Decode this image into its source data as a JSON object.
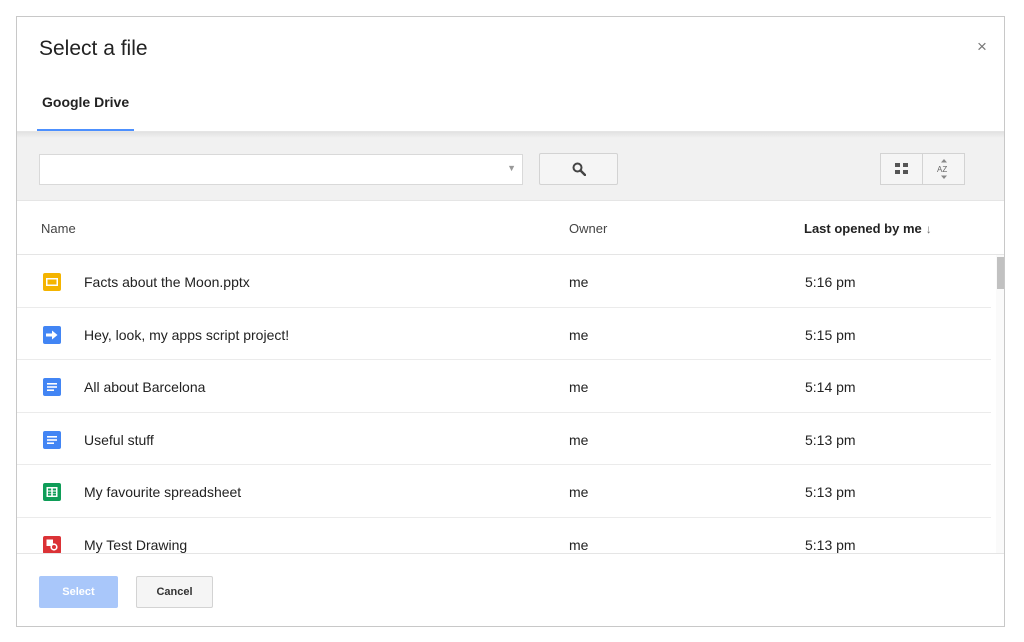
{
  "dialog": {
    "title": "Select a file",
    "close_icon": "close-icon",
    "close_glyph": "×",
    "tabs": [
      {
        "label": "Google Drive",
        "active": true
      }
    ]
  },
  "toolbar": {
    "search_value": "",
    "search_placeholder": "",
    "search_dropdown_icon": "dropdown-icon",
    "search_button_icon": "search-icon",
    "view_buttons": [
      {
        "name": "grid-view",
        "icon": "grid-icon"
      },
      {
        "name": "sort-az",
        "icon": "sort-az-icon",
        "label": "AZ"
      }
    ]
  },
  "list": {
    "columns": {
      "name": "Name",
      "owner": "Owner",
      "opened": "Last opened by me",
      "sort_arrow": "↓"
    },
    "rows": [
      {
        "icon": "slides-icon",
        "name": "Facts about the Moon.pptx",
        "owner": "me",
        "time": "5:16 pm"
      },
      {
        "icon": "apps-script-icon",
        "name": "Hey, look, my apps script project!",
        "owner": "me",
        "time": "5:15 pm"
      },
      {
        "icon": "docs-icon",
        "name": "All about Barcelona",
        "owner": "me",
        "time": "5:14 pm"
      },
      {
        "icon": "docs-icon",
        "name": "Useful stuff",
        "owner": "me",
        "time": "5:13 pm"
      },
      {
        "icon": "sheets-icon",
        "name": "My favourite spreadsheet",
        "owner": "me",
        "time": "5:13 pm"
      },
      {
        "icon": "drawings-icon",
        "name": "My Test Drawing",
        "owner": "me",
        "time": "5:13 pm"
      }
    ]
  },
  "footer": {
    "select_label": "Select",
    "cancel_label": "Cancel"
  },
  "colors": {
    "accent": "#4d90fe",
    "select_disabled": "#a9c7fa",
    "slides": "#f4b400",
    "docs": "#4285f4",
    "sheets": "#0f9d58",
    "drawings": "#db3236"
  }
}
